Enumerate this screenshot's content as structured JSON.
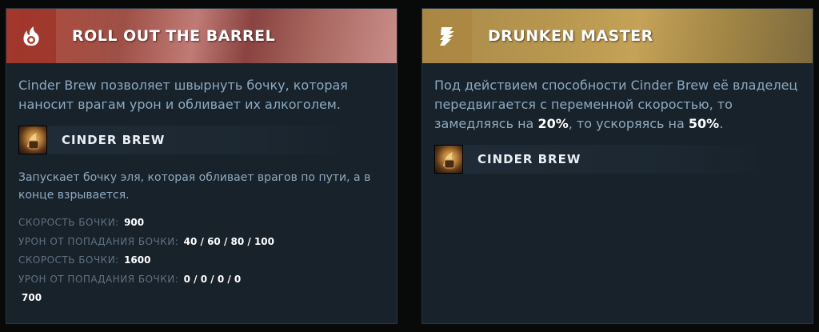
{
  "left_card": {
    "title": "ROLL OUT THE BARREL",
    "icon": "flame-barrel-icon",
    "description": "Cinder Brew позволяет швырнуть бочку, которая наносит врагам урон и обливает их алкоголем.",
    "ability": {
      "name": "CINDER BREW",
      "icon": "cinder-brew-icon",
      "description": "Запускает бочку эля, которая обливает врагов по пути, а в конце взрывается.",
      "stats": [
        {
          "label": "СКОРОСТЬ БОЧКИ:",
          "value": "900"
        },
        {
          "label": "УРОН ОТ ПОПАДАНИЯ БОЧКИ:",
          "value": "40 / 60 / 80 / 100"
        },
        {
          "label": "СКОРОСТЬ БОЧКИ:",
          "value": "1600"
        },
        {
          "label": "УРОН ОТ ПОПАДАНИЯ БОЧКИ:",
          "value": "0 / 0 / 0 / 0"
        }
      ],
      "extra_value": "700"
    },
    "colors": {
      "header_accent": "#b34a3d"
    }
  },
  "right_card": {
    "title": "DRUNKEN MASTER",
    "icon": "winged-boot-icon",
    "description_prefix": "Под действием способности Cinder Brew её владелец передвигается с переменной скоростью, то замедляясь на ",
    "slow_value": "20%",
    "description_middle": ", то ускоряясь на ",
    "speed_value": "50%",
    "description_suffix": ".",
    "ability": {
      "name": "CINDER BREW",
      "icon": "cinder-brew-icon"
    },
    "colors": {
      "header_accent": "#b8974f"
    }
  }
}
